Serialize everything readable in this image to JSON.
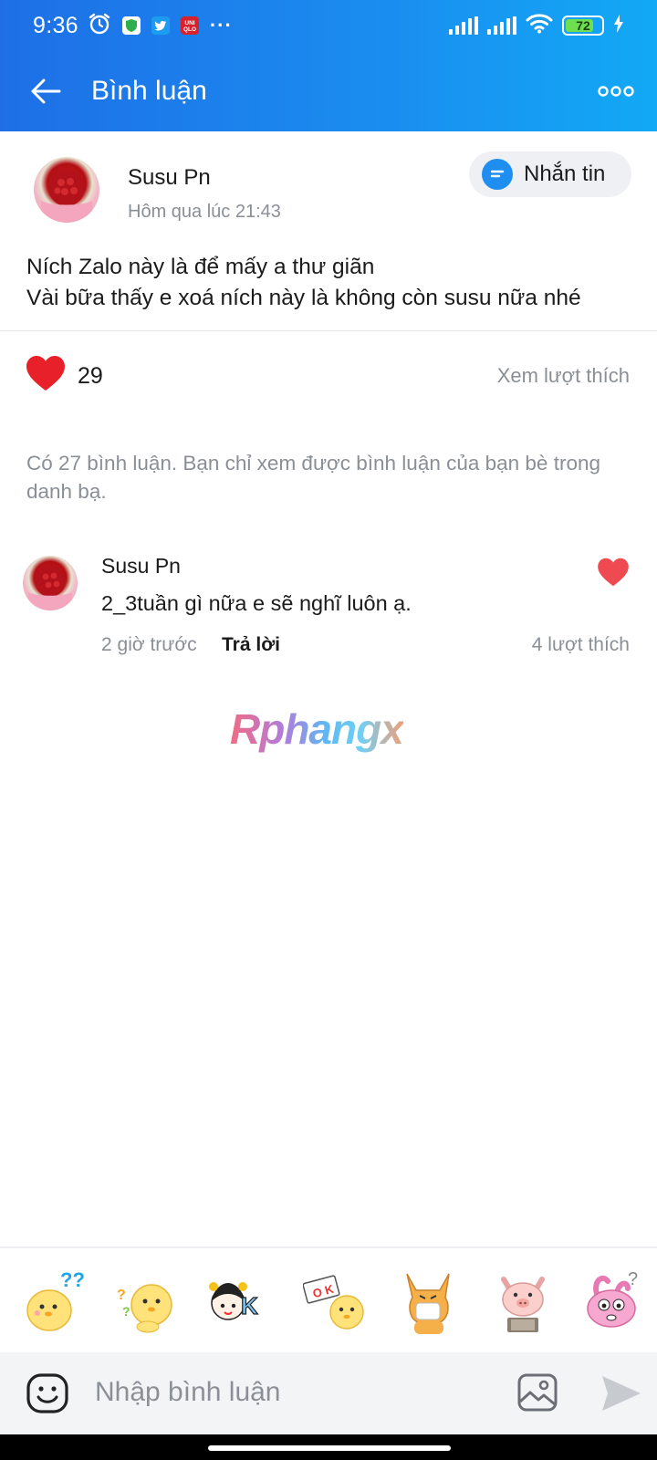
{
  "status_bar": {
    "time": "9:36",
    "app_icons": [
      {
        "name": "alarm-icon"
      },
      {
        "name": "shield-app-icon",
        "color": "#2fae4e"
      },
      {
        "name": "twitter-icon",
        "color": "#1d9bf0"
      },
      {
        "name": "uniqlo-icon",
        "color": "#d8222b",
        "label": "UNI QLO"
      }
    ],
    "more": "···",
    "battery": "72",
    "battery_level": 0.72
  },
  "appbar": {
    "title": "Bình luận"
  },
  "post": {
    "author": "Susu Pn",
    "time": "Hôm qua lúc 21:43",
    "message_button": "Nhắn tin",
    "text_line1": "Ních Zalo này là để mấy a thư giãn",
    "text_line2": "Vài bữa thấy e xoá ních này là không còn susu nữa nhé",
    "like_count": "29",
    "see_likes": "Xem lượt thích",
    "heart_color": "#e8202a"
  },
  "notice": "Có 27 bình luận. Bạn chỉ xem được bình luận của bạn bè trong danh bạ.",
  "comments": [
    {
      "author": "Susu Pn",
      "text": "2_3tuần gì nữa e sẽ nghĩ luôn ạ.",
      "time": "2 giờ trước",
      "reply": "Trả lời",
      "likes": "4 lượt thích",
      "heart_color": "#ef4a52"
    }
  ],
  "watermark": "Rphangx",
  "stickers": [
    {
      "name": "sticker-chick-question-icon"
    },
    {
      "name": "sticker-chick-confused-icon"
    },
    {
      "name": "sticker-girl-ok-icon"
    },
    {
      "name": "sticker-chick-ok-sign-icon"
    },
    {
      "name": "sticker-fox-mask-icon"
    },
    {
      "name": "sticker-pig-icon"
    },
    {
      "name": "sticker-pink-rabbit-icon"
    }
  ],
  "input": {
    "placeholder": "Nhập bình luận"
  },
  "colors": {
    "header_start": "#1e6fe6",
    "header_end": "#12a9f5",
    "muted_text": "#8a8f96"
  }
}
